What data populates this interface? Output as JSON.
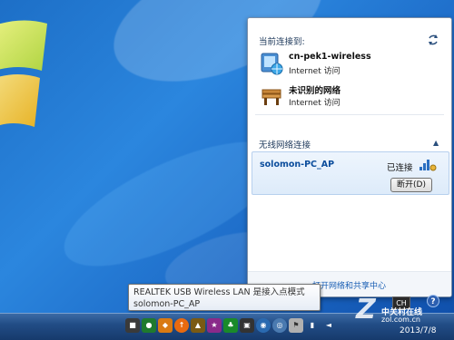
{
  "flyout": {
    "current_label": "当前连接到:",
    "connections": [
      {
        "name": "cn-pek1-wireless",
        "status": "Internet 访问"
      },
      {
        "name": "未识别的网络",
        "status": "Internet 访问"
      }
    ],
    "wireless_section_label": "无线网络连接",
    "active_network": {
      "ssid": "solomon-PC_AP",
      "state": "已连接",
      "disconnect_label": "断开(D)"
    },
    "footer_link": "打开网络和共享中心"
  },
  "tooltip": {
    "line1": "REALTEK USB Wireless LAN 是接入点模式",
    "line2": "solomon-PC_AP"
  },
  "taskbar": {
    "lang": "CH",
    "date": "2013/7/8",
    "help": "?"
  },
  "watermark": {
    "big": "Z",
    "name": "中关村在线",
    "url": "zol.com.cn"
  },
  "colors": {
    "desktop": "#1d6fc7",
    "link": "#1a5fb4",
    "ssid": "#0b4d9c",
    "taskbar": "#224d86"
  },
  "icons": [
    "windows-logo",
    "refresh-icon",
    "network-globe-icon",
    "bench-icon",
    "chevron-up-icon",
    "signal-bars-icon"
  ]
}
